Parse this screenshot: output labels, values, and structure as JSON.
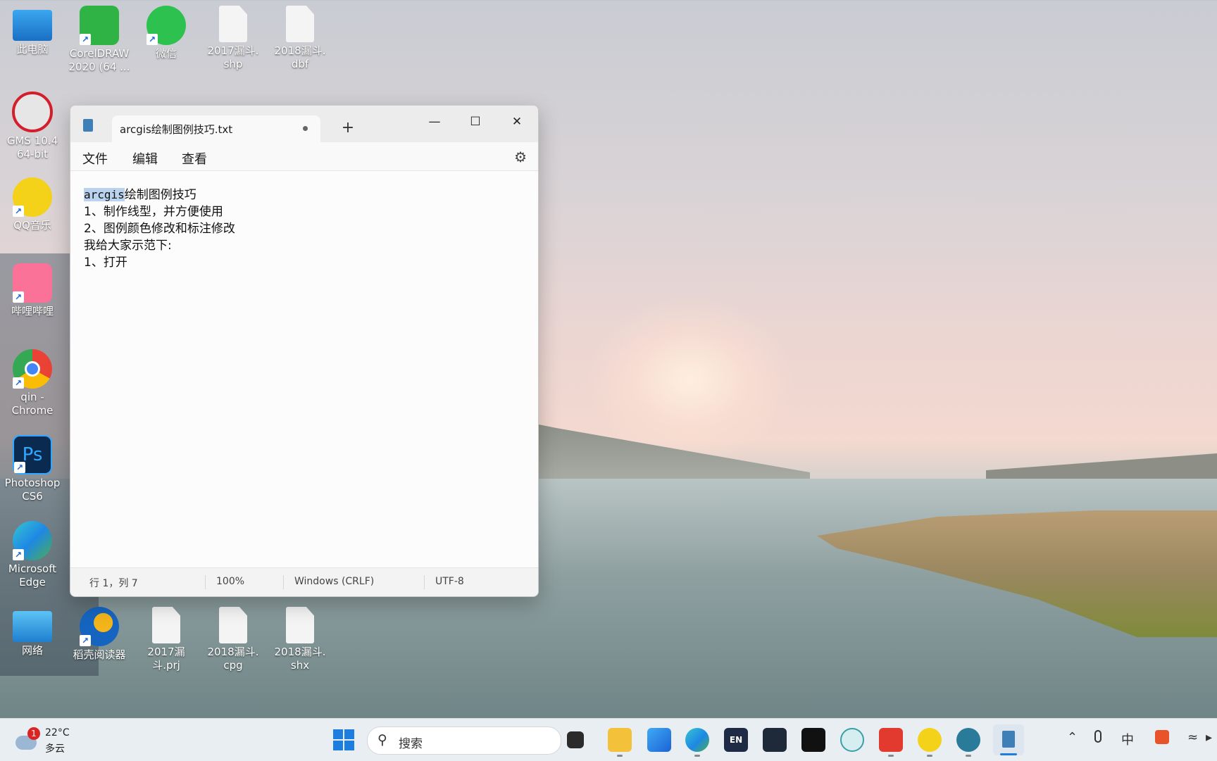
{
  "desktop": {
    "icons": [
      {
        "label": "此电脑"
      },
      {
        "label": "CorelDRAW\n2020 (64 ..."
      },
      {
        "label": "微信"
      },
      {
        "label": "2017漏斗.\nshp"
      },
      {
        "label": "2018漏斗.\ndbf"
      },
      {
        "label": "GMS 10.4\n64-bit"
      },
      {
        "label": "QQ音乐"
      },
      {
        "label": "哔哩哔哩"
      },
      {
        "label": "qin -\nChrome"
      },
      {
        "label": "Photoshop\nCS6"
      },
      {
        "label": "Microsoft\nEdge"
      },
      {
        "label": "网络"
      },
      {
        "label": "稻壳阅读器"
      },
      {
        "label": "2017漏斗.prj"
      },
      {
        "label": "2018漏斗.\ncpg"
      },
      {
        "label": "2018漏斗.\nshx"
      }
    ]
  },
  "notepad": {
    "tab_title": "arcgis绘制图例技巧.txt",
    "new_tab": "+",
    "menus": [
      "文件",
      "编辑",
      "查看"
    ],
    "selected_text": "arcgis",
    "lines": [
      "绘制图例技巧",
      "1、制作线型，并方便使用",
      "2、图例颜色修改和标注修改",
      "我给大家示范下:",
      "1、打开"
    ],
    "status": {
      "position": "行 1，列 7",
      "zoom": "100%",
      "line_ending": "Windows (CRLF)",
      "encoding": "UTF-8"
    }
  },
  "taskbar": {
    "weather_badge": "1",
    "temperature": "22°C",
    "condition": "多云",
    "search_placeholder": "搜索",
    "ime": "中"
  }
}
